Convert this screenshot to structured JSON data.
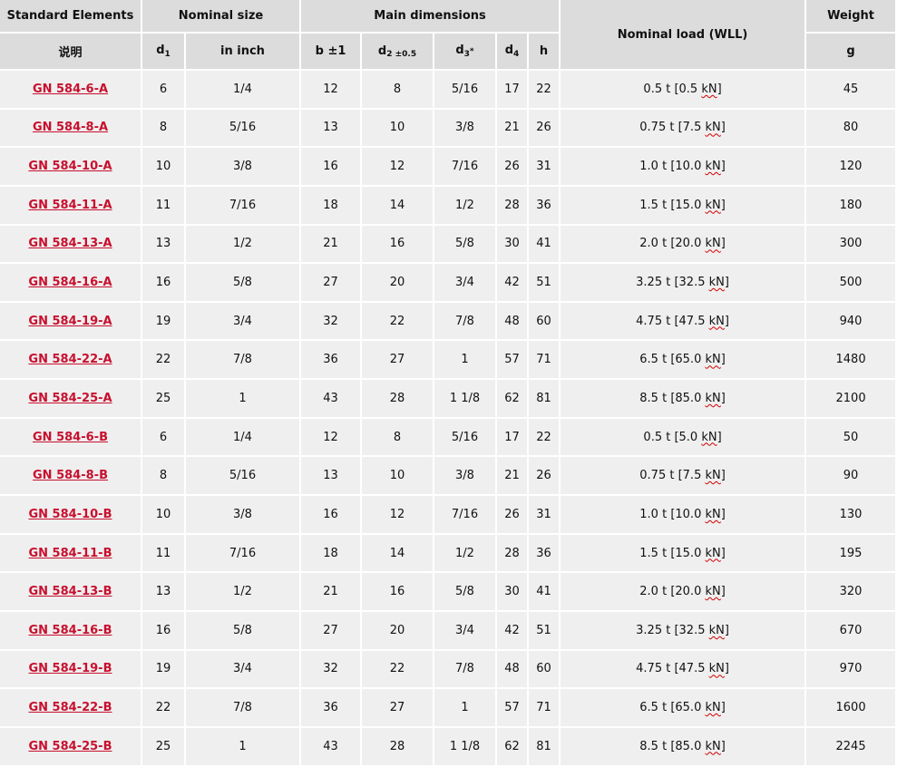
{
  "headers": {
    "standard_elements": "Standard Elements",
    "nominal_size": "Nominal size",
    "main_dimensions": "Main dimensions",
    "nominal_load": "Nominal load (WLL)",
    "weight": "Weight",
    "description": "说明",
    "d1_base": "d",
    "d1_sub": "1",
    "in_inch": "in inch",
    "b": "b ±1",
    "d2_base": "d",
    "d2_sub": "2 ±0.5",
    "d3_base": "d",
    "d3_sub": "3",
    "d3_star": "*",
    "d4_base": "d",
    "d4_sub": "4",
    "h": "h",
    "g": "g"
  },
  "rows": [
    {
      "element": "GN 584-6-A",
      "d1": "6",
      "inch": "1/4",
      "b": "12",
      "d2": "8",
      "d3": "5/16",
      "d4": "17",
      "h": "22",
      "load_t": "0.5 t [0.5",
      "load_kn": "kN",
      "load_close": "]",
      "weight": "45"
    },
    {
      "element": "GN 584-8-A",
      "d1": "8",
      "inch": "5/16",
      "b": "13",
      "d2": "10",
      "d3": "3/8",
      "d4": "21",
      "h": "26",
      "load_t": "0.75 t [7.5",
      "load_kn": "kN",
      "load_close": "]",
      "weight": "80"
    },
    {
      "element": "GN 584-10-A",
      "d1": "10",
      "inch": "3/8",
      "b": "16",
      "d2": "12",
      "d3": "7/16",
      "d4": "26",
      "h": "31",
      "load_t": "1.0 t [10.0",
      "load_kn": "kN",
      "load_close": "]",
      "weight": "120"
    },
    {
      "element": "GN 584-11-A",
      "d1": "11",
      "inch": "7/16",
      "b": "18",
      "d2": "14",
      "d3": "1/2",
      "d4": "28",
      "h": "36",
      "load_t": "1.5 t [15.0",
      "load_kn": "kN",
      "load_close": "]",
      "weight": "180"
    },
    {
      "element": "GN 584-13-A",
      "d1": "13",
      "inch": "1/2",
      "b": "21",
      "d2": "16",
      "d3": "5/8",
      "d4": "30",
      "h": "41",
      "load_t": "2.0 t [20.0",
      "load_kn": "kN",
      "load_close": "]",
      "weight": "300"
    },
    {
      "element": "GN 584-16-A",
      "d1": "16",
      "inch": "5/8",
      "b": "27",
      "d2": "20",
      "d3": "3/4",
      "d4": "42",
      "h": "51",
      "load_t": "3.25 t [32.5",
      "load_kn": "kN",
      "load_close": "]",
      "weight": "500"
    },
    {
      "element": "GN 584-19-A",
      "d1": "19",
      "inch": "3/4",
      "b": "32",
      "d2": "22",
      "d3": "7/8",
      "d4": "48",
      "h": "60",
      "load_t": "4.75 t [47.5",
      "load_kn": "kN",
      "load_close": "]",
      "weight": "940"
    },
    {
      "element": "GN 584-22-A",
      "d1": "22",
      "inch": "7/8",
      "b": "36",
      "d2": "27",
      "d3": "1",
      "d4": "57",
      "h": "71",
      "load_t": "6.5 t [65.0",
      "load_kn": "kN",
      "load_close": "]",
      "weight": "1480"
    },
    {
      "element": "GN 584-25-A",
      "d1": "25",
      "inch": "1",
      "b": "43",
      "d2": "28",
      "d3": "1 1/8",
      "d4": "62",
      "h": "81",
      "load_t": "8.5 t [85.0",
      "load_kn": "kN",
      "load_close": "]",
      "weight": "2100"
    },
    {
      "element": "GN 584-6-B",
      "d1": "6",
      "inch": "1/4",
      "b": "12",
      "d2": "8",
      "d3": "5/16",
      "d4": "17",
      "h": "22",
      "load_t": "0.5 t [5.0",
      "load_kn": "kN",
      "load_close": "]",
      "weight": "50"
    },
    {
      "element": "GN 584-8-B",
      "d1": "8",
      "inch": "5/16",
      "b": "13",
      "d2": "10",
      "d3": "3/8",
      "d4": "21",
      "h": "26",
      "load_t": "0.75 t [7.5",
      "load_kn": "kN",
      "load_close": "]",
      "weight": "90"
    },
    {
      "element": "GN 584-10-B",
      "d1": "10",
      "inch": "3/8",
      "b": "16",
      "d2": "12",
      "d3": "7/16",
      "d4": "26",
      "h": "31",
      "load_t": "1.0 t [10.0",
      "load_kn": "kN",
      "load_close": "]",
      "weight": "130"
    },
    {
      "element": "GN 584-11-B",
      "d1": "11",
      "inch": "7/16",
      "b": "18",
      "d2": "14",
      "d3": "1/2",
      "d4": "28",
      "h": "36",
      "load_t": "1.5 t [15.0",
      "load_kn": "kN",
      "load_close": "]",
      "weight": "195"
    },
    {
      "element": "GN 584-13-B",
      "d1": "13",
      "inch": "1/2",
      "b": "21",
      "d2": "16",
      "d3": "5/8",
      "d4": "30",
      "h": "41",
      "load_t": "2.0 t [20.0",
      "load_kn": "kN",
      "load_close": "]",
      "weight": "320"
    },
    {
      "element": "GN 584-16-B",
      "d1": "16",
      "inch": "5/8",
      "b": "27",
      "d2": "20",
      "d3": "3/4",
      "d4": "42",
      "h": "51",
      "load_t": "3.25 t [32.5",
      "load_kn": "kN",
      "load_close": "]",
      "weight": "670"
    },
    {
      "element": "GN 584-19-B",
      "d1": "19",
      "inch": "3/4",
      "b": "32",
      "d2": "22",
      "d3": "7/8",
      "d4": "48",
      "h": "60",
      "load_t": "4.75 t [47.5",
      "load_kn": "kN",
      "load_close": "]",
      "weight": "970"
    },
    {
      "element": "GN 584-22-B",
      "d1": "22",
      "inch": "7/8",
      "b": "36",
      "d2": "27",
      "d3": "1",
      "d4": "57",
      "h": "71",
      "load_t": "6.5 t [65.0",
      "load_kn": "kN",
      "load_close": "]",
      "weight": "1600"
    },
    {
      "element": "GN 584-25-B",
      "d1": "25",
      "inch": "1",
      "b": "43",
      "d2": "28",
      "d3": "1 1/8",
      "d4": "62",
      "h": "81",
      "load_t": "8.5 t [85.0",
      "load_kn": "kN",
      "load_close": "]",
      "weight": "2245"
    }
  ],
  "colors": {
    "header_bg": "#dcdcdc",
    "row_bg": "#efefef",
    "link": "#c8102e",
    "spellcheck": "#d00000"
  }
}
